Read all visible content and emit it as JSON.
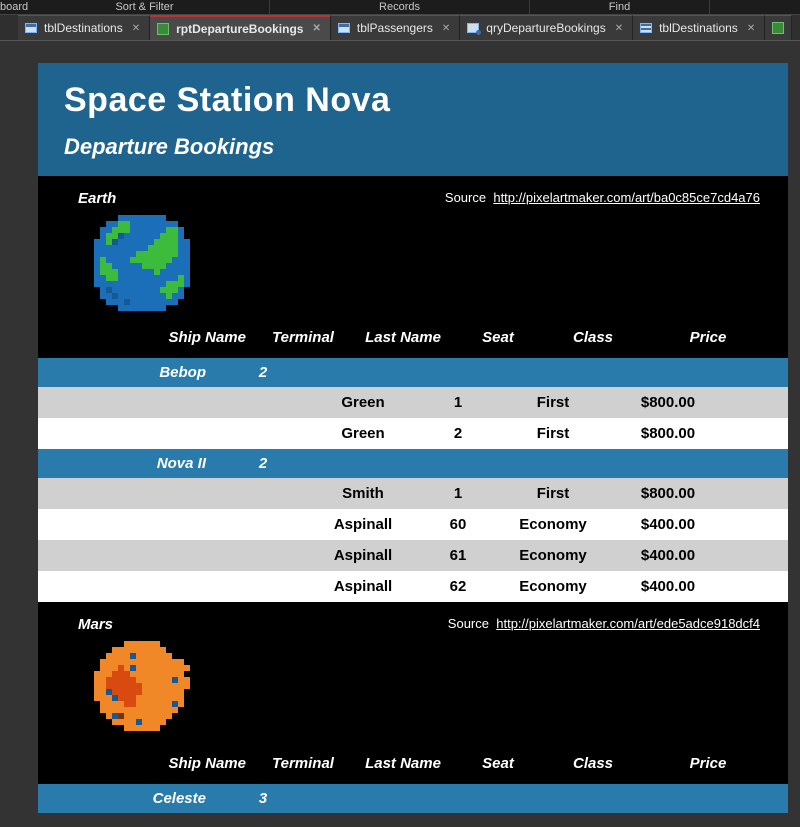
{
  "ribbon": {
    "clipboard_lbl": "board",
    "sort_filter_lbl": "Sort & Filter",
    "records_lbl": "Records",
    "find_lbl": "Find"
  },
  "tabs": [
    {
      "label": "tblDestinations",
      "icon": "table-icon",
      "active": false
    },
    {
      "label": "rptDepartureBookings",
      "icon": "report-icon",
      "active": true
    },
    {
      "label": "tblPassengers",
      "icon": "table-icon",
      "active": false
    },
    {
      "label": "qryDepartureBookings",
      "icon": "query-icon",
      "active": false
    },
    {
      "label": "tblDestinations",
      "icon": "table2-icon",
      "active": false
    }
  ],
  "report": {
    "title": "Space Station Nova",
    "subtitle": "Departure Bookings",
    "source_label": "Source",
    "columns": {
      "ship": "Ship Name",
      "terminal": "Terminal",
      "last": "Last Name",
      "seat": "Seat",
      "class": "Class",
      "price": "Price"
    },
    "sections": [
      {
        "destination": "Earth",
        "source_url": "http://pixelartmaker.com/art/ba0c85ce7cd4a76",
        "planet": "earth",
        "ships": [
          {
            "name": "Bebop",
            "terminal": "2",
            "rows": [
              {
                "last": "Green",
                "seat": "1",
                "class": "First",
                "price": "$800.00"
              },
              {
                "last": "Green",
                "seat": "2",
                "class": "First",
                "price": "$800.00"
              }
            ]
          },
          {
            "name": "Nova II",
            "terminal": "2",
            "rows": [
              {
                "last": "Smith",
                "seat": "1",
                "class": "First",
                "price": "$800.00"
              },
              {
                "last": "Aspinall",
                "seat": "60",
                "class": "Economy",
                "price": "$400.00"
              },
              {
                "last": "Aspinall",
                "seat": "61",
                "class": "Economy",
                "price": "$400.00"
              },
              {
                "last": "Aspinall",
                "seat": "62",
                "class": "Economy",
                "price": "$400.00"
              }
            ]
          }
        ]
      },
      {
        "destination": "Mars",
        "source_url": "http://pixelartmaker.com/art/ede5adce918dcf4",
        "planet": "mars",
        "ships": [
          {
            "name": "Celeste",
            "terminal": "3",
            "rows": []
          }
        ]
      }
    ]
  }
}
